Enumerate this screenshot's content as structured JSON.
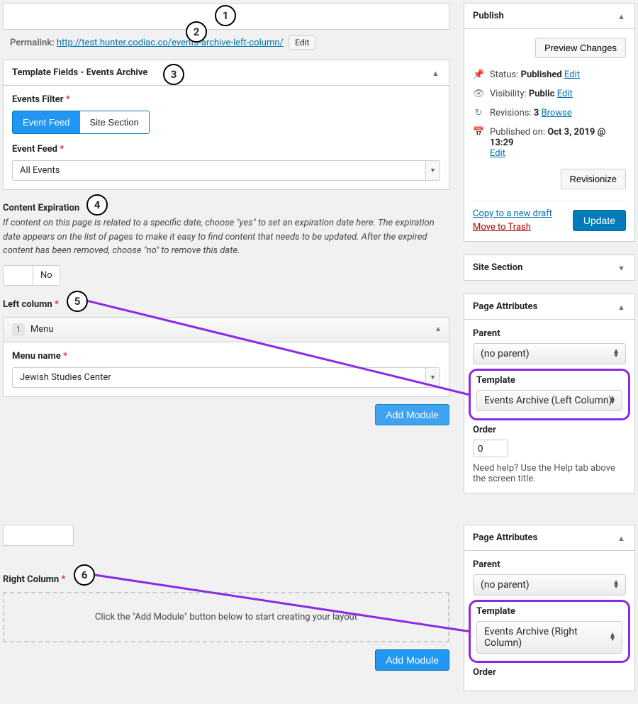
{
  "annotations": {
    "c1": "1",
    "c2": "2",
    "c3": "3",
    "c4": "4",
    "c5": "5",
    "c6": "6"
  },
  "permalink": {
    "label": "Permalink:",
    "base": "http://test.hunter.codiac.co/",
    "slug": "events-archive-left-column/",
    "edit": "Edit"
  },
  "templateFields": {
    "boxTitle": "Template Fields - Events Archive",
    "eventsFilterLabel": "Events Filter",
    "eventFeedBtn": "Event Feed",
    "siteSectionBtn": "Site Section",
    "eventFeedLabel": "Event Feed",
    "eventFeedSelected": "All Events"
  },
  "expiration": {
    "title": "Content Expiration",
    "desc": "If content on this page is related to a specific date, choose \"yes\" to set an expiration date here. The expiration date appears on the list of pages to make it easy to find content that needs to be updated. After the expired content has been removed, choose \"no\" to remove this date.",
    "no": "No"
  },
  "leftColumn": {
    "title": "Left column",
    "rowNum": "1",
    "rowLabel": "Menu",
    "menuNameLabel": "Menu name",
    "menuNameValue": "Jewish Studies Center",
    "addModule": "Add Module"
  },
  "rightColumn": {
    "title": "Right Column",
    "emptyMsg": "Click the \"Add Module\" button below to start creating your layout",
    "addModule": "Add Module"
  },
  "publish": {
    "boxTitle": "Publish",
    "preview": "Preview Changes",
    "statusLabel": "Status:",
    "statusValue": "Published",
    "statusEdit": "Edit",
    "visibilityLabel": "Visibility:",
    "visibilityValue": "Public",
    "visibilityEdit": "Edit",
    "revisionsLabel": "Revisions:",
    "revisionsValue": "3",
    "revisionsBrowse": "Browse",
    "publishedLabel": "Published on:",
    "publishedValue": "Oct 3, 2019 @ 13:29",
    "publishedEdit": "Edit",
    "revisionize": "Revisionize",
    "copyDraft": "Copy to a new draft",
    "trash": "Move to Trash",
    "update": "Update"
  },
  "siteSection": {
    "boxTitle": "Site Section"
  },
  "pageAttr1": {
    "boxTitle": "Page Attributes",
    "parentLabel": "Parent",
    "parentValue": "(no parent)",
    "templateLabel": "Template",
    "templateValue": "Events Archive (Left Column)",
    "orderLabel": "Order",
    "orderValue": "0",
    "help": "Need help? Use the Help tab above the screen title."
  },
  "pageAttr2": {
    "boxTitle": "Page Attributes",
    "parentLabel": "Parent",
    "parentValue": "(no parent)",
    "templateLabel": "Template",
    "templateValue": "Events Archive (Right Column)",
    "orderLabel": "Order"
  }
}
